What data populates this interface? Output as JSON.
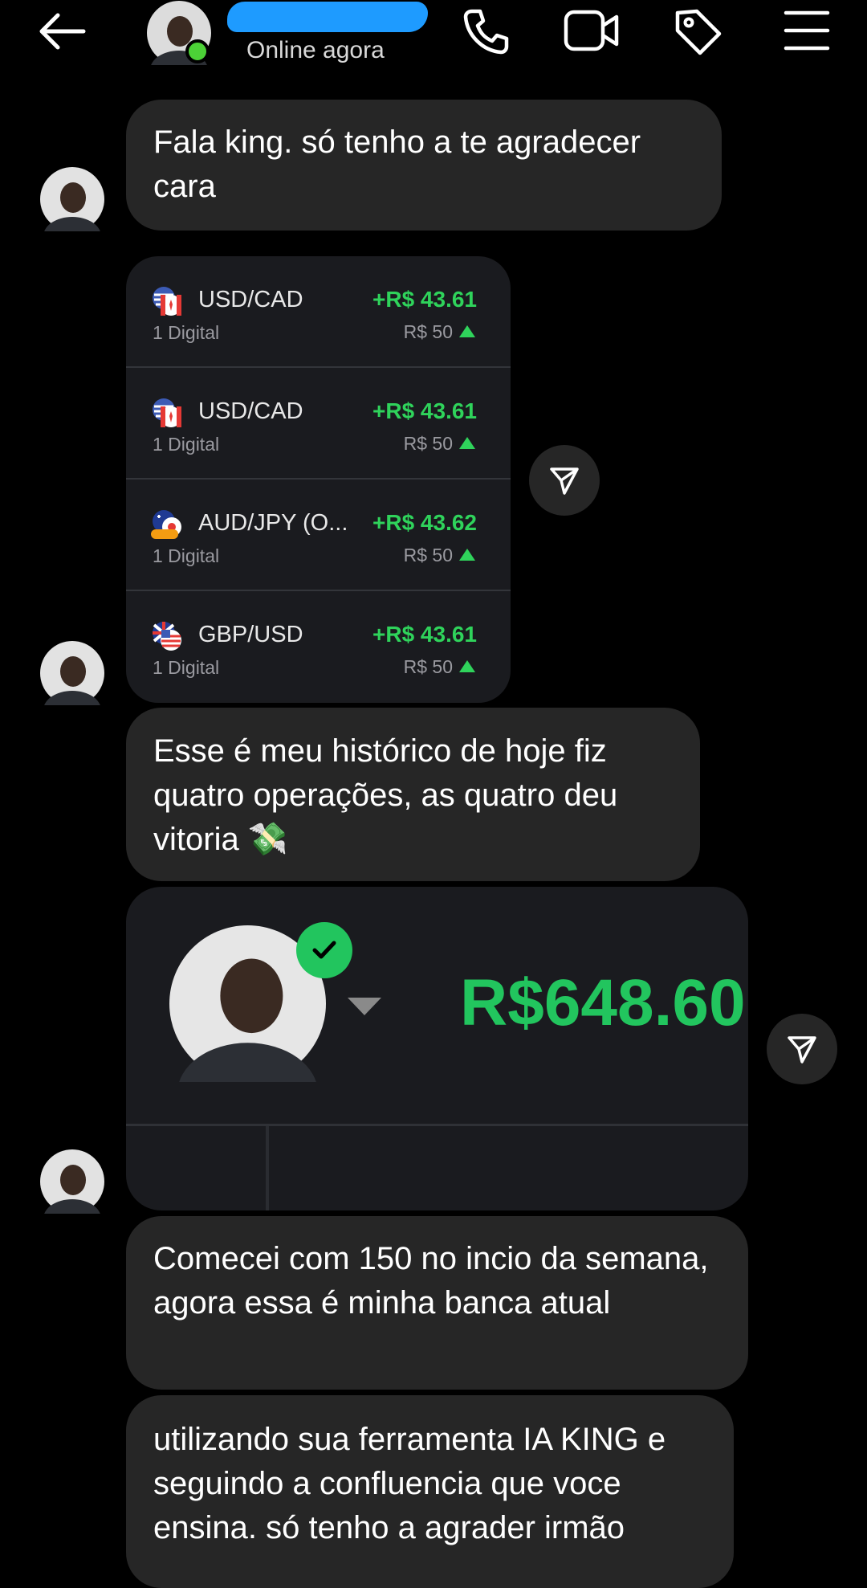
{
  "header": {
    "status": "Online agora",
    "icons": [
      "back-arrow-icon",
      "phone-icon",
      "video-icon",
      "tag-icon",
      "menu-icon"
    ]
  },
  "messages": [
    {
      "type": "text",
      "text": "Fala king. só tenho a te agradecer cara"
    },
    {
      "type": "text",
      "text": "Esse é meu histórico de hoje fiz quatro operações, as quatro deu vitoria 💸"
    },
    {
      "type": "text",
      "text": "Comecei com 150 no incio da semana, agora essa é minha banca atual"
    },
    {
      "type": "text",
      "text": "utilizando sua ferramenta IA KING e seguindo a confluencia que voce ensina. só tenho a agrader irmão"
    }
  ],
  "trades": [
    {
      "pair": "USD/CAD",
      "type": "1 Digital",
      "profit": "+R$ 43.61",
      "stake": "R$ 50",
      "flag": "us-ca-flag-icon"
    },
    {
      "pair": "USD/CAD",
      "type": "1 Digital",
      "profit": "+R$ 43.61",
      "stake": "R$ 50",
      "flag": "us-ca-flag-icon"
    },
    {
      "pair": "AUD/JPY (O...",
      "type": "1 Digital",
      "profit": "+R$ 43.62",
      "stake": "R$ 50",
      "flag": "au-jp-otc-flag-icon"
    },
    {
      "pair": "GBP/USD",
      "type": "1 Digital",
      "profit": "+R$ 43.61",
      "stake": "R$ 50",
      "flag": "gb-us-flag-icon"
    }
  ],
  "balance": {
    "amount": "R$648.60"
  },
  "colors": {
    "bubble": "#262626",
    "profit_green": "#2fd35b",
    "online": "#4cd137",
    "background": "#000000"
  }
}
